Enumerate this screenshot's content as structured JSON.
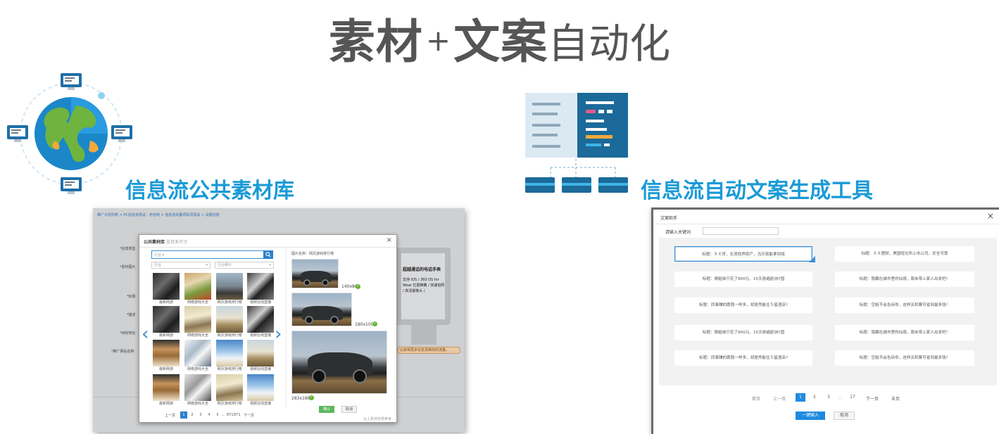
{
  "title": {
    "part1": "素材",
    "plus": "+",
    "part2": "文案",
    "part3": "自动化"
  },
  "left_section": {
    "heading": "信息流公共素材库",
    "background_page": {
      "breadcrumb": "推广计划列表 > PC信息流测试 - 赤佳莉 > 信息流关键词投词测试 > 设置创意",
      "fields": [
        "*创意类型",
        "*素材图片",
        "*标题",
        "*描述",
        "*目标地址",
        "*推广网站名称"
      ],
      "monitor_title": "超越通话的电话手表",
      "monitor_text": "支持 iOS / 360 OS for Wear 位置精确 / 快速拍照 / 高清摄像头 /",
      "tip": "以获得更多信息流媒体的流量。"
    },
    "modal": {
      "title": "公共素材库",
      "subtitle": "支持多尺寸",
      "close": "×",
      "search_category": "行业",
      "search_arrow": "▾",
      "search_icon": "search-icon",
      "select_industry": "行业",
      "select_industry_detail": "行业细分",
      "select_arrow": "▾",
      "prev_arrow": "‹",
      "next_arrow": "›",
      "thumbnails": [
        {
          "label": "最新网游",
          "style": "t-dark"
        },
        {
          "label": "网络游戏大全",
          "style": "t-game"
        },
        {
          "label": "网页游戏排行榜",
          "style": "t-car"
        },
        {
          "label": "视频在线直播",
          "style": "t-cam"
        },
        {
          "label": "最新网游",
          "style": "t-dark"
        },
        {
          "label": "网络游戏大全",
          "style": "t-bottle"
        },
        {
          "label": "网页游戏排行榜",
          "style": "t-road"
        },
        {
          "label": "视频在线直播",
          "style": "t-cam"
        },
        {
          "label": "最新网游",
          "style": "t-pipe"
        },
        {
          "label": "网络游戏大全",
          "style": "t-pen"
        },
        {
          "label": "网页游戏排行榜",
          "style": "t-skier"
        },
        {
          "label": "视频在线直播",
          "style": "t-road"
        },
        {
          "label": "最新网游",
          "style": "t-pipe"
        },
        {
          "label": "网络游戏大全",
          "style": "t-gym"
        },
        {
          "label": "网页游戏排行榜",
          "style": "t-bottle"
        },
        {
          "label": "视频在线直播",
          "style": "t-skier"
        }
      ],
      "image_name": "图片名称：网页游戏排行榜",
      "previews": [
        {
          "size": "140x88"
        },
        {
          "size": "180x100"
        },
        {
          "size": "283x188"
        }
      ],
      "check_mark": "✓",
      "confirm": "确认",
      "cancel": "取消",
      "footnote": "以上素材仅供参考",
      "pager": {
        "prev": "上一页",
        "pages": [
          "1",
          "2",
          "3",
          "4",
          "5"
        ],
        "active": "1",
        "ellipsis": "...",
        "tail": "871",
        "tail2": "871",
        "next": "下一页"
      }
    }
  },
  "right_section": {
    "heading": "信息流自动文案生成工具",
    "dialog": {
      "title": "文案助手",
      "close": "×",
      "keyword_label": "请输入关键词",
      "keyword_value": "",
      "items": [
        "标题：ＸＸ贷，无须抵押资产，当天就能拿到钱",
        "标题：ＸＸ理财，美国纽交所上市公司，安全可靠",
        "标题：俩姐妹只花了800元，15天游遍欧洲7国",
        "标题：隐藏在城市里的仙境，周末带上家人出发吧！",
        "标题：同事赚的跟我一样多，却居然能住５星酒店?",
        "标题：空姐不会告诉你，这样买机票可省到最多钱！",
        "标题：俩姐妹只花了800元，15天游遍欧洲7国",
        "标题：隐藏在城市里的仙境，周末带上家人出发吧！",
        "标题：同事赚的跟我一样多，却居然能住５星酒店?",
        "标题：空姐不会告诉你，这样买机票可省到最多钱！"
      ],
      "pager": {
        "first": "首页",
        "prev": "上一页",
        "pages": [
          "1",
          "2",
          "3"
        ],
        "active": "1",
        "ellipsis": "...",
        "last_num": "17",
        "next": "下一页",
        "last": "末页"
      },
      "primary_button": "一键输入",
      "cancel_button": "取消"
    }
  },
  "colors": {
    "accent": "#1a9ad6",
    "title_gray": "#555555",
    "primary_blue": "#1f8ae0",
    "confirm_green": "#5cb85c"
  }
}
